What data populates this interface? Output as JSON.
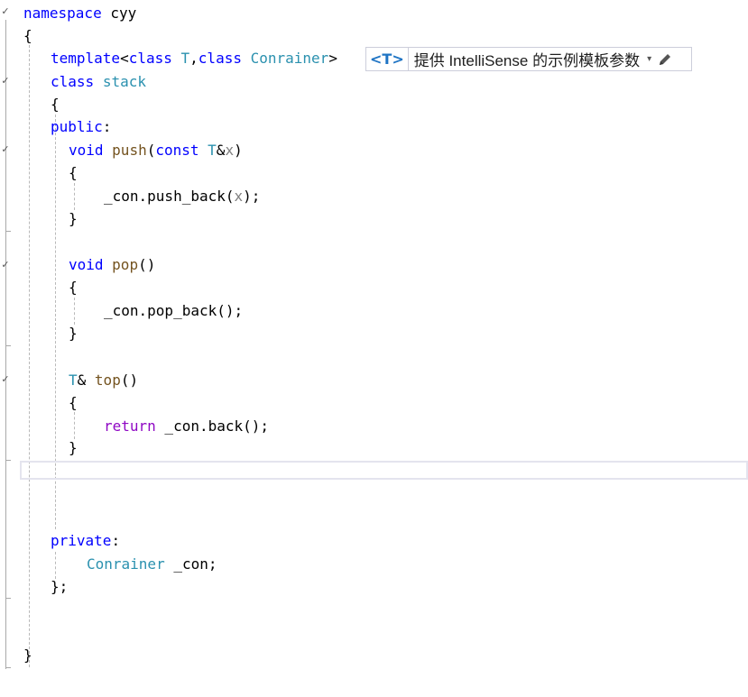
{
  "editor": {
    "lines": {
      "l1": {
        "kw": "namespace",
        "rest": " cyy"
      },
      "l2": {
        "text": "{"
      },
      "l3": {
        "kw": "template",
        "p1": "<",
        "kw2": "class",
        "sp1": " ",
        "ty1": "T",
        "comma": ",",
        "kw3": "class",
        "sp2": " ",
        "ty2": "Conrainer",
        "p2": ">"
      },
      "l4": {
        "kw": "class",
        "sp": " ",
        "ty": "stack"
      },
      "l5": {
        "text": "{"
      },
      "l6": {
        "kw": "public",
        "rest": ":"
      },
      "l7": {
        "kw": "void",
        "sp": " ",
        "fn": "push",
        "p1": "(",
        "kw2": "const",
        "sp2": " ",
        "ty": "T",
        "amp": "&",
        "prm": "x",
        "p2": ")"
      },
      "l8": {
        "text": "{"
      },
      "l9": {
        "text": "_con.push_back(",
        "prm": "x",
        "end": ");"
      },
      "l10": {
        "text": "}"
      },
      "l11": {
        "kw": "void",
        "sp": " ",
        "fn": "pop",
        "rest": "()"
      },
      "l12": {
        "text": "{"
      },
      "l13": {
        "text": "_con.pop_back();"
      },
      "l14": {
        "text": "}"
      },
      "l15": {
        "ty": "T",
        "amp": "&",
        "sp": " ",
        "fn": "top",
        "rest": "()"
      },
      "l16": {
        "text": "{"
      },
      "l17": {
        "kw": "return",
        "rest": " _con.back();"
      },
      "l18": {
        "text": "}"
      },
      "l19": {
        "kw": "private",
        "rest": ":"
      },
      "l20": {
        "ty": "Conrainer",
        "rest": " _con;"
      },
      "l21": {
        "text": "};"
      },
      "l22": {
        "text": "}"
      }
    }
  },
  "hint": {
    "badge": "<T>",
    "text": "提供 IntelliSense 的示例模板参数",
    "caret": "▾",
    "edit_icon": "pencil-icon"
  },
  "fold_glyph": "✓",
  "colors": {
    "keyword": "#0000ff",
    "control_keyword": "#8f08c4",
    "type": "#2b91af",
    "function": "#74531f",
    "parameter": "#808080",
    "hint_badge": "#1e74c4"
  }
}
